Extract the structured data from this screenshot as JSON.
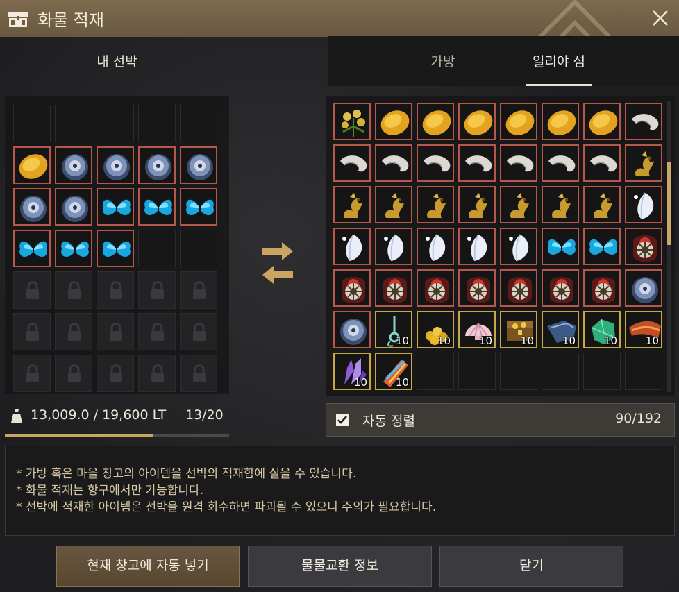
{
  "window": {
    "title": "화물 적재",
    "close_icon": "close-icon",
    "title_icon": "cargo-chest-icon"
  },
  "left": {
    "header": "내 선박",
    "weight_text": "13,009.0 / 19,600 LT",
    "slots_text": "13/20",
    "weight_fraction": 0.66,
    "grid": {
      "columns": 5,
      "rows": 7,
      "slots": [
        "",
        "",
        "",
        "",
        "",
        "gold-disc",
        "silver-disc",
        "silver-disc",
        "silver-disc",
        "silver-disc",
        "silver-disc",
        "silver-disc",
        "butterfly",
        "butterfly",
        "butterfly",
        "butterfly",
        "butterfly",
        "butterfly",
        "",
        "",
        "locked",
        "locked",
        "locked",
        "locked",
        "locked",
        "locked",
        "locked",
        "locked",
        "locked",
        "locked",
        "locked",
        "locked",
        "locked",
        "locked",
        "locked"
      ]
    }
  },
  "transfer_icon": "transfer-arrows-icon",
  "right": {
    "tabs": [
      {
        "label": "가방",
        "active": false
      },
      {
        "label": "일리야 섬",
        "active": true
      }
    ],
    "grid": {
      "columns": 8,
      "slots": [
        {
          "item": "herb"
        },
        {
          "item": "gold-disc"
        },
        {
          "item": "gold-disc"
        },
        {
          "item": "gold-disc"
        },
        {
          "item": "gold-disc"
        },
        {
          "item": "gold-disc"
        },
        {
          "item": "gold-disc"
        },
        {
          "item": "shrimp"
        },
        {
          "item": "shrimp"
        },
        {
          "item": "shrimp"
        },
        {
          "item": "shrimp"
        },
        {
          "item": "shrimp"
        },
        {
          "item": "shrimp"
        },
        {
          "item": "shrimp"
        },
        {
          "item": "shrimp"
        },
        {
          "item": "dragon"
        },
        {
          "item": "dragon"
        },
        {
          "item": "dragon"
        },
        {
          "item": "dragon"
        },
        {
          "item": "dragon"
        },
        {
          "item": "dragon"
        },
        {
          "item": "dragon"
        },
        {
          "item": "dragon"
        },
        {
          "item": "crystal-leaf"
        },
        {
          "item": "crystal-leaf"
        },
        {
          "item": "crystal-leaf"
        },
        {
          "item": "crystal-leaf"
        },
        {
          "item": "crystal-leaf"
        },
        {
          "item": "crystal-leaf"
        },
        {
          "item": "butterfly"
        },
        {
          "item": "butterfly"
        },
        {
          "item": "seal"
        },
        {
          "item": "seal"
        },
        {
          "item": "seal"
        },
        {
          "item": "seal"
        },
        {
          "item": "seal"
        },
        {
          "item": "seal"
        },
        {
          "item": "seal"
        },
        {
          "item": "seal"
        },
        {
          "item": "silver-disc"
        },
        {
          "item": "silver-disc"
        },
        {
          "item": "key",
          "count": "10",
          "gold": true
        },
        {
          "item": "coins",
          "count": "10",
          "gold": true
        },
        {
          "item": "shell",
          "count": "10",
          "gold": true
        },
        {
          "item": "chest",
          "count": "10",
          "gold": true
        },
        {
          "item": "cloth",
          "count": "10",
          "gold": true
        },
        {
          "item": "jade",
          "count": "10",
          "gold": true
        },
        {
          "item": "wing",
          "count": "10",
          "gold": true
        },
        {
          "item": "amethyst",
          "count": "10",
          "gold": true
        },
        {
          "item": "scroll",
          "count": "10",
          "gold": true
        },
        {
          "item": ""
        },
        {
          "item": ""
        },
        {
          "item": ""
        },
        {
          "item": ""
        },
        {
          "item": ""
        },
        {
          "item": ""
        }
      ]
    },
    "auto_sort_label": "자동 정렬",
    "auto_sort_checked": true,
    "capacity_text": "90/192"
  },
  "notes": [
    "* 가방 혹은 마을 창고의 아이템을 선박의 적재함에 실을 수 있습니다.",
    "* 화물 적재는 항구에서만 가능합니다.",
    "* 선박에 적재한 아이템은 선박을 원격 회수하면 파괴될 수 있으니 주의가 필요합니다."
  ],
  "buttons": {
    "auto_load": "현재 창고에 자동 넣기",
    "barter_info": "물물교환 정보",
    "close": "닫기"
  },
  "colors": {
    "accent": "#c9a561",
    "slot_border_red": "#b5574a",
    "slot_border_gold": "#c8a843"
  }
}
